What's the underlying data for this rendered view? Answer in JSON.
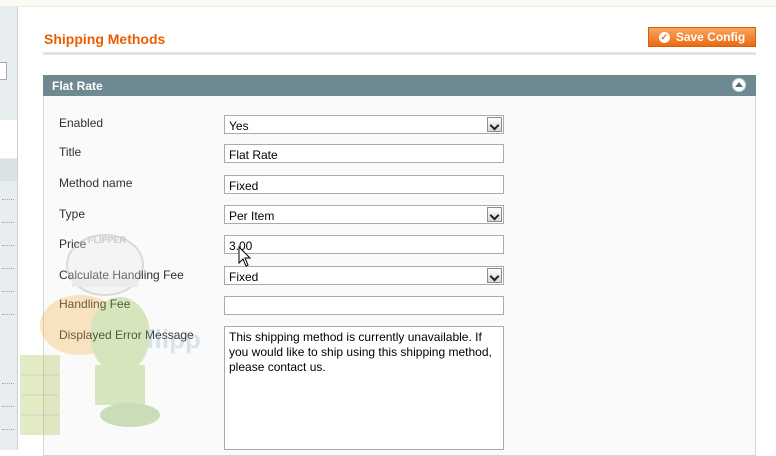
{
  "page": {
    "title": "Shipping Methods",
    "save_button": "Save Config"
  },
  "section": {
    "title": "Flat Rate"
  },
  "fields": {
    "enabled": {
      "label": "Enabled",
      "value": "Yes"
    },
    "title": {
      "label": "Title",
      "value": "Flat Rate"
    },
    "method_name": {
      "label": "Method name",
      "value": "Fixed"
    },
    "type": {
      "label": "Type",
      "value": "Per Item"
    },
    "price": {
      "label": "Price",
      "value": "3.00"
    },
    "calc_handling_fee": {
      "label": "Calculate Handling Fee",
      "value": "Fixed"
    },
    "handling_fee": {
      "label": "Handling Fee",
      "value": ""
    },
    "error_message": {
      "label": "Displayed Error Message",
      "value": "This shipping method is currently unavailable. If you would like to ship using this shipping method, please contact us."
    }
  },
  "watermark": {
    "brand": "FLIPPER",
    "logo": "flipper"
  },
  "colors": {
    "accent": "#eb5e00",
    "header_bg": "#6f8992",
    "button": "#ed6a12"
  },
  "icons": {
    "save": "check-circle-icon",
    "collapse": "collapse-up-icon",
    "dropdown": "chevron-down-icon",
    "cursor": "mouse-pointer-icon"
  }
}
